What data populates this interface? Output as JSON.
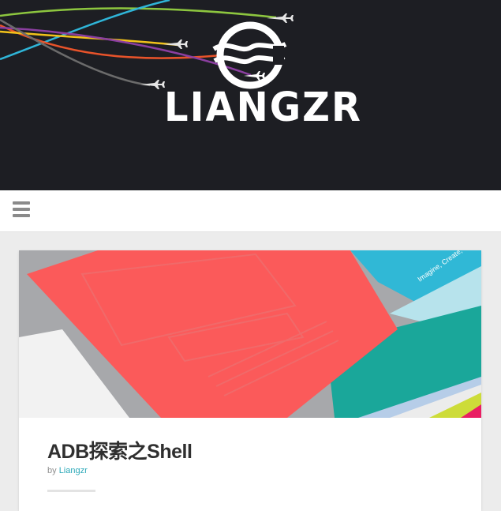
{
  "site": {
    "logo_text": "LIANGZR"
  },
  "nav": {
    "menu_icon": "hamburger-menu-icon"
  },
  "post": {
    "title": "ADB探索之Shell",
    "by_label": "by",
    "author": "Liangzr",
    "image_text": "Imagine, Create,"
  },
  "colors": {
    "header_bg": "#1d1e23",
    "page_bg": "#ececec",
    "accent_link": "#2aa8b8",
    "card_red": "#fb5a5a",
    "card_cyan": "#30b8d6"
  }
}
